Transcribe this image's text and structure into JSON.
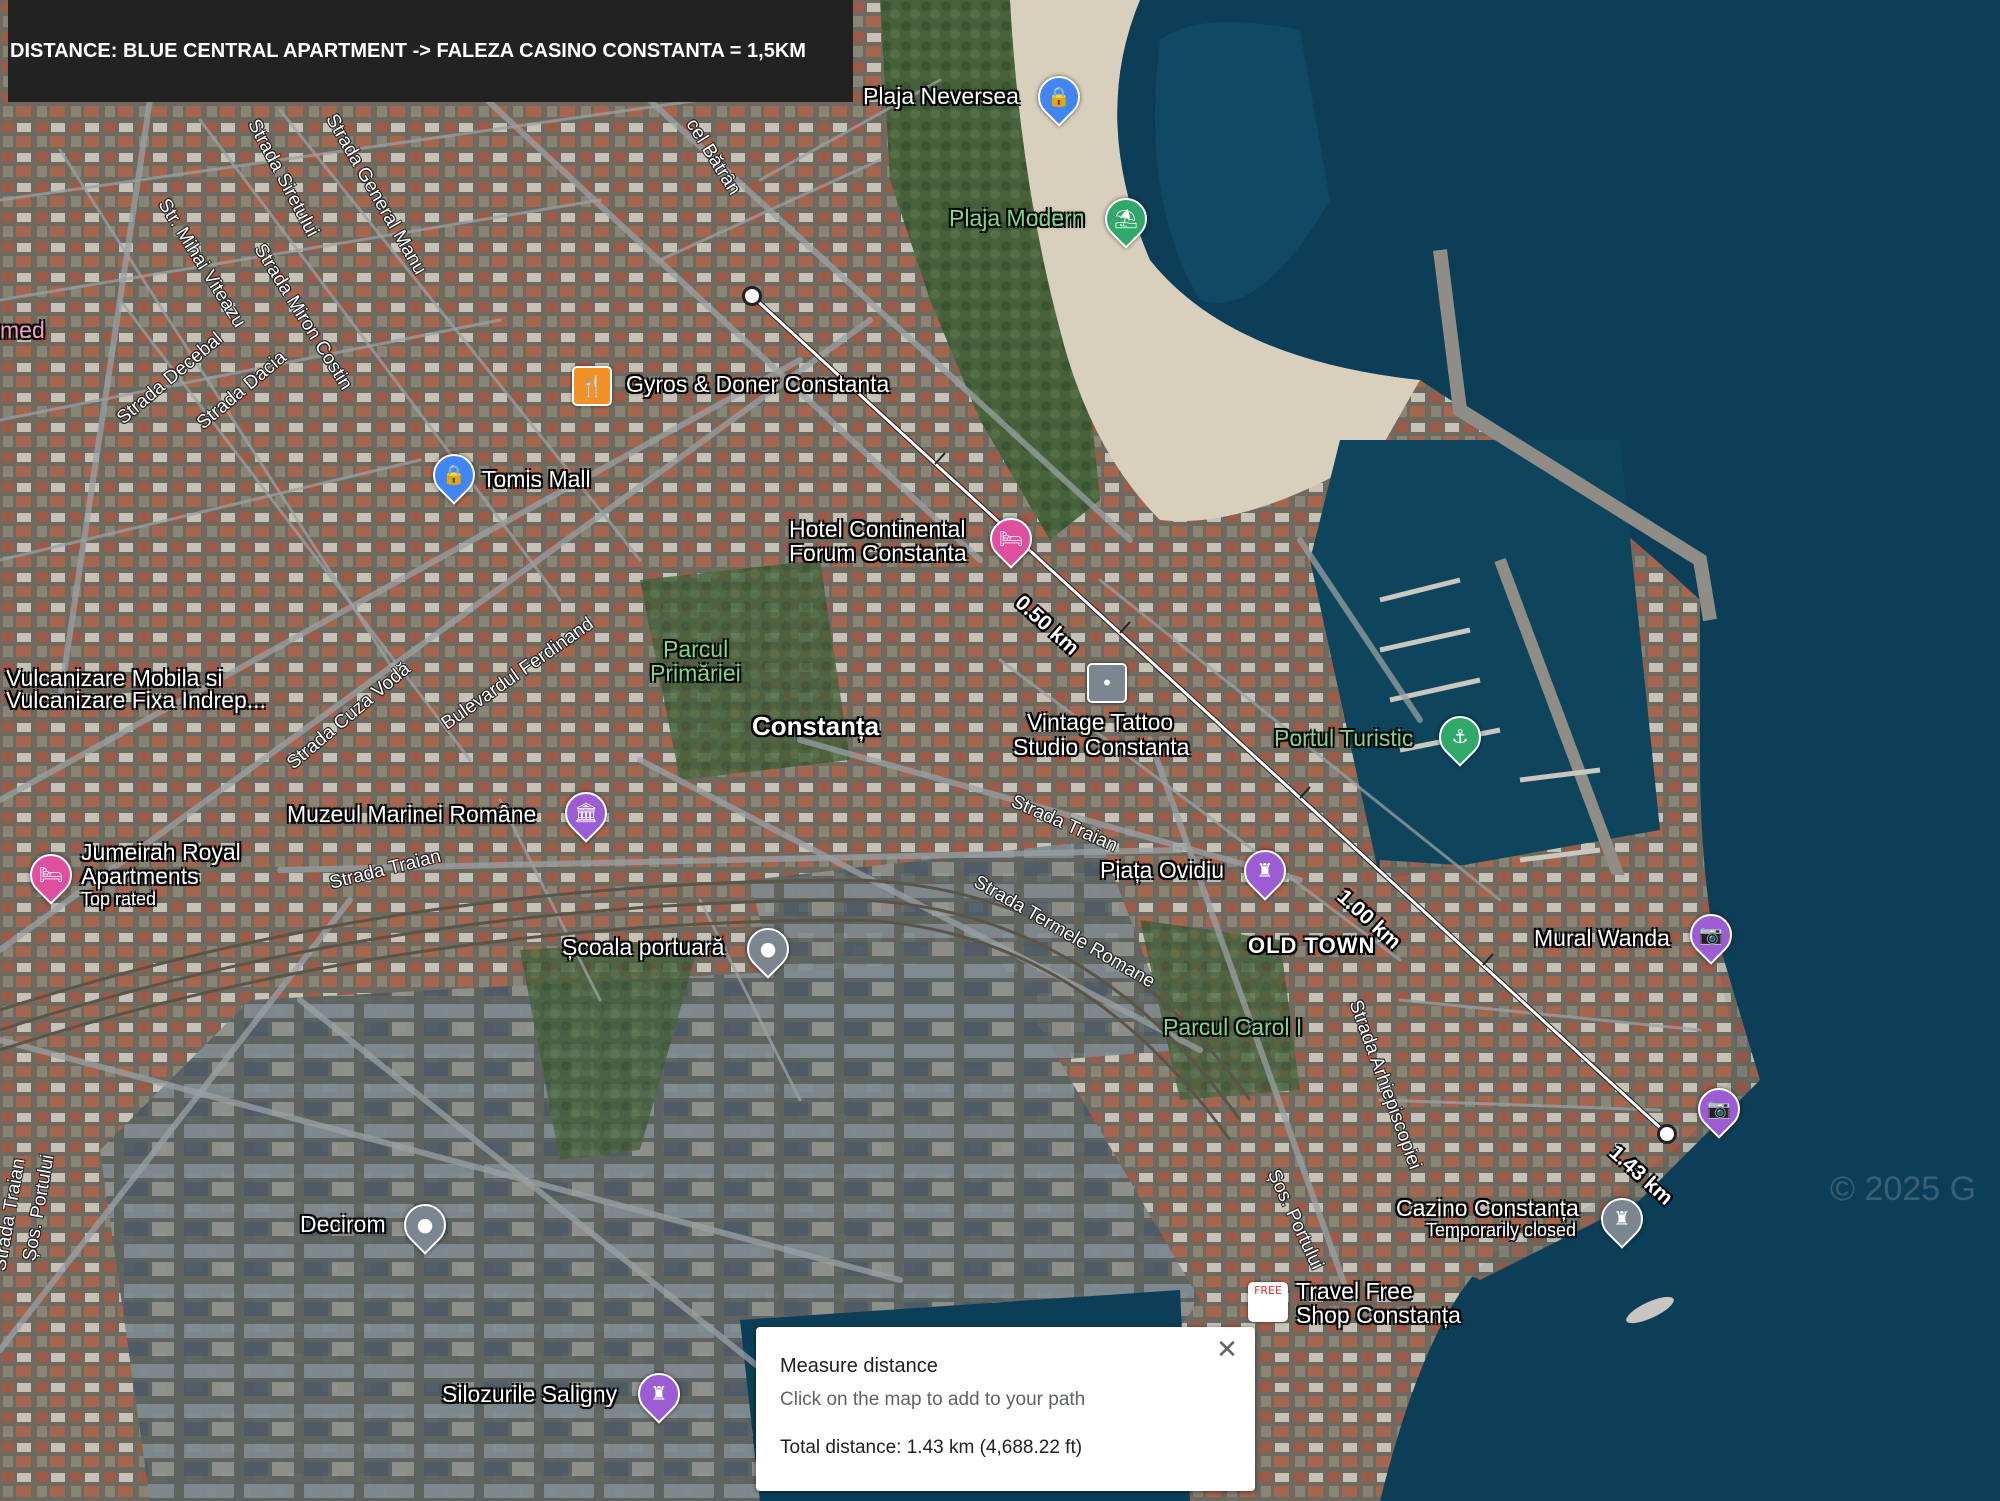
{
  "banner": {
    "text": "DISTANCE: BLUE CENTRAL APARTMENT -> FALEZA CASINO CONSTANTA = 1,5KM"
  },
  "places": {
    "plaja_neversea": "Plaja Neversea",
    "plaja_modern": "Plaja Modern",
    "gyros": "Gyros & Doner Constanta",
    "tomis_mall": "Tomis Mall",
    "hotel_continental_1": "Hotel Continental",
    "hotel_continental_2": "Forum Constanta",
    "parcul_primariei_1": "Parcul",
    "parcul_primariei_2": "Primăriei",
    "constanta": "Constanța",
    "vintage_1": "Vintage Tattoo",
    "vintage_2": "Studio Constanta",
    "portul_turistic": "Portul Turistic",
    "vulcanizare_1": "Vulcanizare Mobila si",
    "vulcanizare_2": "Vulcanizare Fixa Indrep...",
    "muzeul": "Muzeul Marinei Române",
    "jumeirah_1": "Jumeirah Royal",
    "jumeirah_2": "Apartments",
    "jumeirah_3": "Top rated",
    "piata_ovidiu": "Piața Ovidiu",
    "old_town": "OLD TOWN",
    "mural_wanda": "Mural Wanda",
    "scoala": "Școala portuară",
    "parcul_carol": "Parcul Carol I",
    "decirom": "Decirom",
    "cazino_1": "Cazino Constanța",
    "cazino_2": "Temporarily closed",
    "travel_free_1": "Travel Free",
    "travel_free_2": "Shop Constanța",
    "silozurile": "Silozurile Saligny",
    "med": "med"
  },
  "streets": {
    "s1": "cel Bătrân",
    "s2": "Strada Siretului",
    "s3": "Strada General Manu",
    "s4": "Str. Mihai Viteazu",
    "s5": "Strada Miron Costin",
    "s6": "Strada Decebal",
    "s7": "Strada Dacia",
    "s8": "Bulevardul Ferdinand",
    "s9": "Strada Cuza Vodă",
    "s10": "Strada Traian",
    "s11": "Strada Traian",
    "s12": "Strada Termele Romane",
    "s13": "Strada Arhiepiscopiei",
    "s14": "Șos. Portului",
    "s15": "Șos. Portului",
    "s16": "Strada Traian"
  },
  "measure": {
    "labels": [
      "0.50 km",
      "1.00 km",
      "1.43 km"
    ],
    "total_km": 1.43
  },
  "panel": {
    "title": "Measure distance",
    "hint": "Click on the map to add to your path",
    "total": "Total distance: 1.43 km (4,688.22 ft)",
    "close": "✕"
  },
  "watermark": "© 2025 G",
  "icons": {
    "shopping": "shopping-bag-icon",
    "restaurant": "fork-knife-icon",
    "hotel": "bed-icon",
    "beach": "beach-umbrella-icon",
    "camera": "camera-icon",
    "museum": "museum-icon",
    "monument": "monument-icon",
    "marina": "boat-icon",
    "generic": "location-dot-icon"
  },
  "colors": {
    "pin_blue": "#4285f4",
    "pin_orange": "#f29226",
    "pin_pink": "#e04f9f",
    "pin_purple": "#9c5cd4",
    "pin_green": "#2fa86a",
    "pin_gray": "#7b8690",
    "sea": "#0d3e57",
    "banner_bg": "#222222"
  }
}
